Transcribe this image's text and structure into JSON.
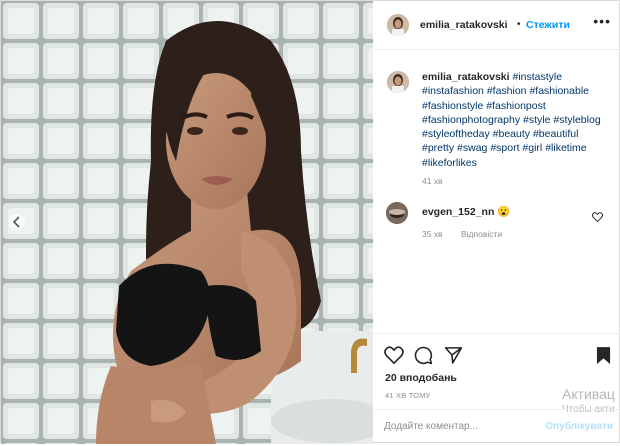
{
  "header": {
    "username": "emilia_ratakovski",
    "dot": "•",
    "follow_label": "Стежити",
    "more_label": "•••"
  },
  "caption": {
    "username": "emilia_ratakovski",
    "hashtags": [
      "#instastyle",
      "#instafashion",
      "#fashion",
      "#fashionable",
      "#fashionstyle",
      "#fashionpost",
      "#fashionphotography",
      "#style",
      "#styleblog",
      "#styleoftheday",
      "#beauty",
      "#beautiful",
      "#pretty",
      "#swag",
      "#sport",
      "#girl",
      "#liketime",
      "#likeforlikes"
    ],
    "time": "41 хв"
  },
  "comment": {
    "username": "evgen_152_nn",
    "emoji": "😮",
    "time": "35 хв",
    "reply_label": "Відповісти"
  },
  "actions": {
    "icons": [
      "heart-icon",
      "comment-icon",
      "share-icon",
      "bookmark-icon"
    ],
    "likes": "20 вподобань",
    "posted_ago": "41 ХВ ТОМУ"
  },
  "add_comment": {
    "placeholder": "Додайте коментар...",
    "post_label": "Опублікувати"
  },
  "watermark": {
    "line1": "Активац",
    "line2": "Чтобы акти"
  },
  "colors": {
    "link": "#00376b",
    "follow": "#0095f6",
    "muted": "#8e8e8e"
  }
}
